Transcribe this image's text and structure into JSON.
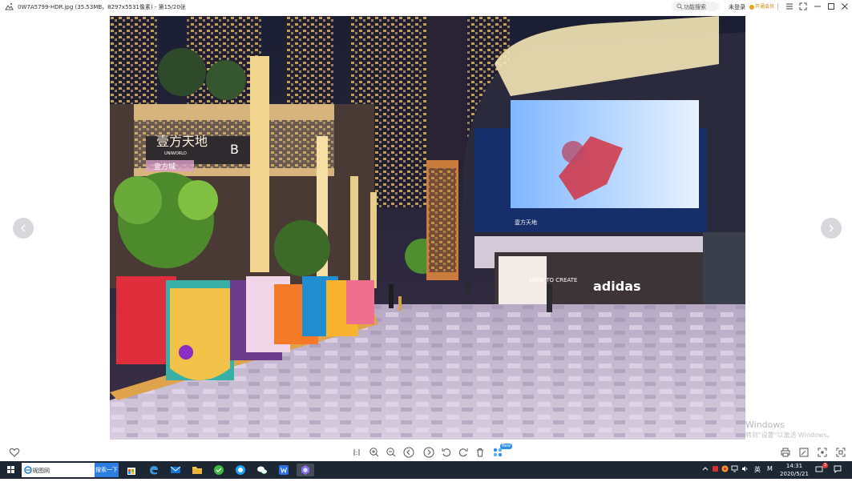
{
  "titlebar": {
    "file_title": "0W7A5799-HDR.jpg (35.53MB，8297x5531像素) - 第15/20张",
    "search_placeholder": "功能搜索",
    "login_label": "未登录",
    "vip_label": "开通会员"
  },
  "photo": {
    "sign_brand": "壹方天地",
    "sign_brand_en": "UNIWORLD",
    "sign_right": "B",
    "sign_sub": "壹方城",
    "store_sign": "adidas",
    "store_sub": "HERE TO CREATE",
    "mall_sign": "壹方天地",
    "letters": "UNIWORLD"
  },
  "watermark": {
    "line1": "Windows",
    "line2": "转到\"设置\"以激活 Windows。"
  },
  "toolbar": {
    "new_badge": "New"
  },
  "taskbar": {
    "search_value": "昵图网",
    "search_button": "搜索一下",
    "tray_ime": "英",
    "tray_m": "M",
    "time": "14:31",
    "date": "2020/5/21",
    "notification_count": "3"
  },
  "colors": {
    "accent": "#2b7de0",
    "taskbar_bg": "#1c2733",
    "vip": "#e5a21e",
    "badge": "#e53935"
  }
}
